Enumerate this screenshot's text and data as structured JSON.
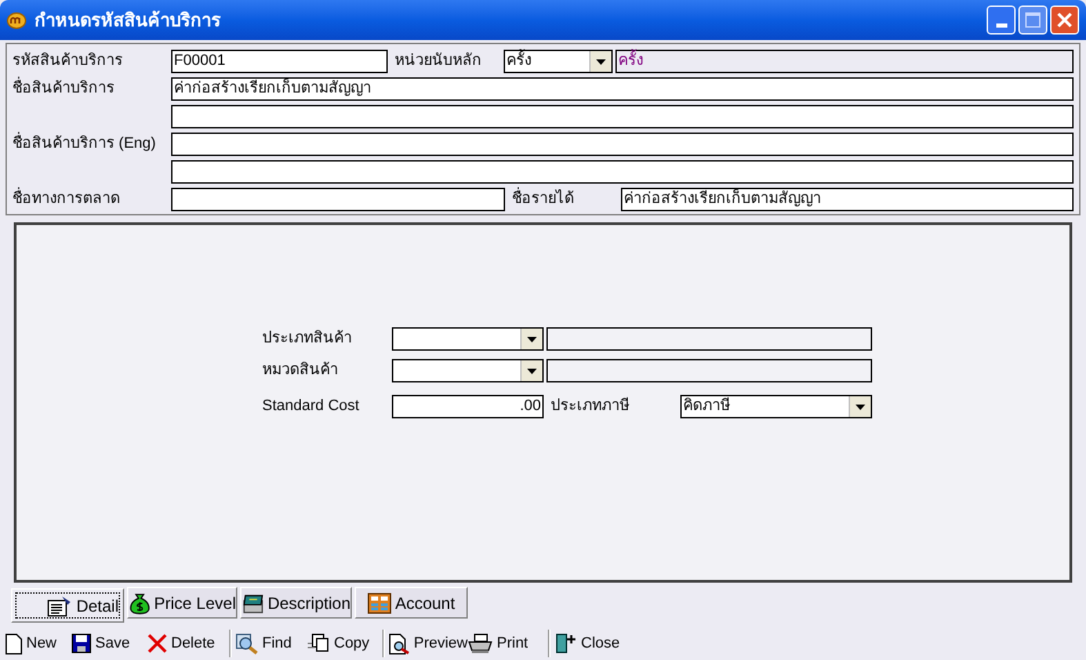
{
  "window": {
    "title": "กำหนดรหัสสินค้าบริการ"
  },
  "header": {
    "code_label": "รหัสสินค้าบริการ",
    "code_value": "F00001",
    "unit_label": "หน่วยนับหลัก",
    "unit_value": "ครั้ง",
    "unit_name": "ครั้ง",
    "name_label": "ชื่อสินค้าบริการ",
    "name_value": "ค่าก่อสร้างเรียกเก็บตามสัญญา",
    "name_eng_label": "ชื่อสินค้าบริการ (Eng)",
    "marketing_label": "ชื่อทางการตลาด",
    "income_label": "ชื่อรายได้",
    "income_value": "ค่าก่อสร้างเรียกเก็บตามสัญญา"
  },
  "detail": {
    "type_label": "ประเภทสินค้า",
    "category_label": "หมวดสินค้า",
    "cost_label": "Standard Cost",
    "cost_value": ".00",
    "tax_label": "ประเภทภาษี",
    "tax_value": "คิดภาษี"
  },
  "tabs": [
    {
      "label": "Detail",
      "selected": true
    },
    {
      "label": "Price Level",
      "selected": false
    },
    {
      "label": "Description",
      "selected": false
    },
    {
      "label": "Account",
      "selected": false
    }
  ],
  "toolbar": [
    {
      "label": "New",
      "separator_before": false
    },
    {
      "label": "Save",
      "separator_before": false
    },
    {
      "label": "Delete",
      "separator_before": false
    },
    {
      "label": "Find",
      "separator_before": true
    },
    {
      "label": "Copy",
      "separator_before": false
    },
    {
      "label": "Preview",
      "separator_before": true
    },
    {
      "label": "Print",
      "separator_before": false
    },
    {
      "label": "Close",
      "separator_before": true
    }
  ]
}
